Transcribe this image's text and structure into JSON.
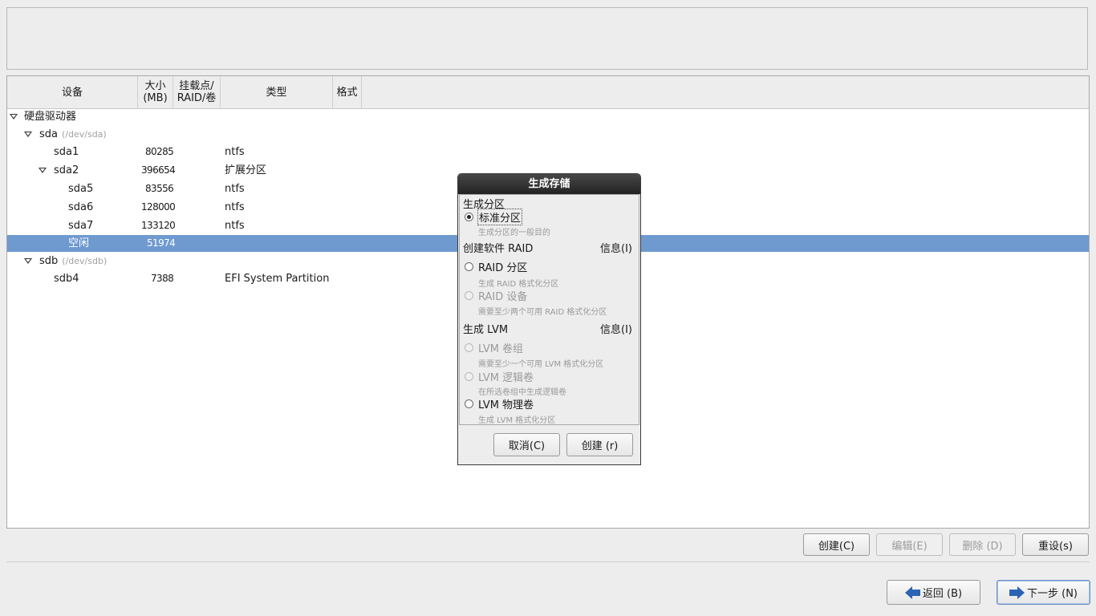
{
  "columns": {
    "device": "设备",
    "size": [
      "大小",
      "(MB)"
    ],
    "mount": [
      "挂载点/",
      "RAID/卷"
    ],
    "type": "类型",
    "format": "格式"
  },
  "tree": {
    "root": "硬盘驱动器",
    "sda": {
      "name": "sda",
      "path": "(/dev/sda)"
    },
    "sda1": {
      "name": "sda1",
      "size": "80285",
      "type": "ntfs"
    },
    "sda2": {
      "name": "sda2",
      "size": "396654",
      "type": "扩展分区"
    },
    "sda5": {
      "name": "sda5",
      "size": "83556",
      "type": "ntfs"
    },
    "sda6": {
      "name": "sda6",
      "size": "128000",
      "type": "ntfs"
    },
    "sda7": {
      "name": "sda7",
      "size": "133120",
      "type": "ntfs"
    },
    "free": {
      "name": "空闲",
      "size": "51974"
    },
    "sdb": {
      "name": "sdb",
      "path": "(/dev/sdb)"
    },
    "sdb4": {
      "name": "sdb4",
      "size": "7388",
      "type": "EFI System Partition"
    }
  },
  "dialog": {
    "title": "生成存储",
    "section_partition": "生成分区",
    "standard_label": "标准分区",
    "standard_desc": "生成分区的一般目的",
    "section_raid": "创建软件 RAID",
    "raid_info": "信息(I)",
    "raid_partition_label": "RAID 分区",
    "raid_partition_desc": "生成 RAID 格式化分区",
    "raid_device_label": "RAID 设备",
    "raid_device_desc": "需要至少两个可用 RAID 格式化分区",
    "section_lvm": "生成 LVM",
    "lvm_info": "信息(I)",
    "lvm_vg_label": "LVM 卷组",
    "lvm_vg_desc": "需要至少一个可用 LVM 格式化分区",
    "lvm_lv_label": "LVM 逻辑卷",
    "lvm_lv_desc": "在所选卷组中生成逻辑卷",
    "lvm_pv_label": "LVM 物理卷",
    "lvm_pv_desc": "生成 LVM 格式化分区",
    "cancel": "取消(C)",
    "create": "创建 (r)"
  },
  "actions": {
    "create": "创建(C)",
    "edit": "编辑(E)",
    "delete": "删除 (D)",
    "reset": "重设(s)"
  },
  "nav": {
    "back": "返回 (B)",
    "next": "下一步 (N)"
  },
  "colors": {
    "selection": "#6f9ad0",
    "arrow": "#2d63b3"
  }
}
